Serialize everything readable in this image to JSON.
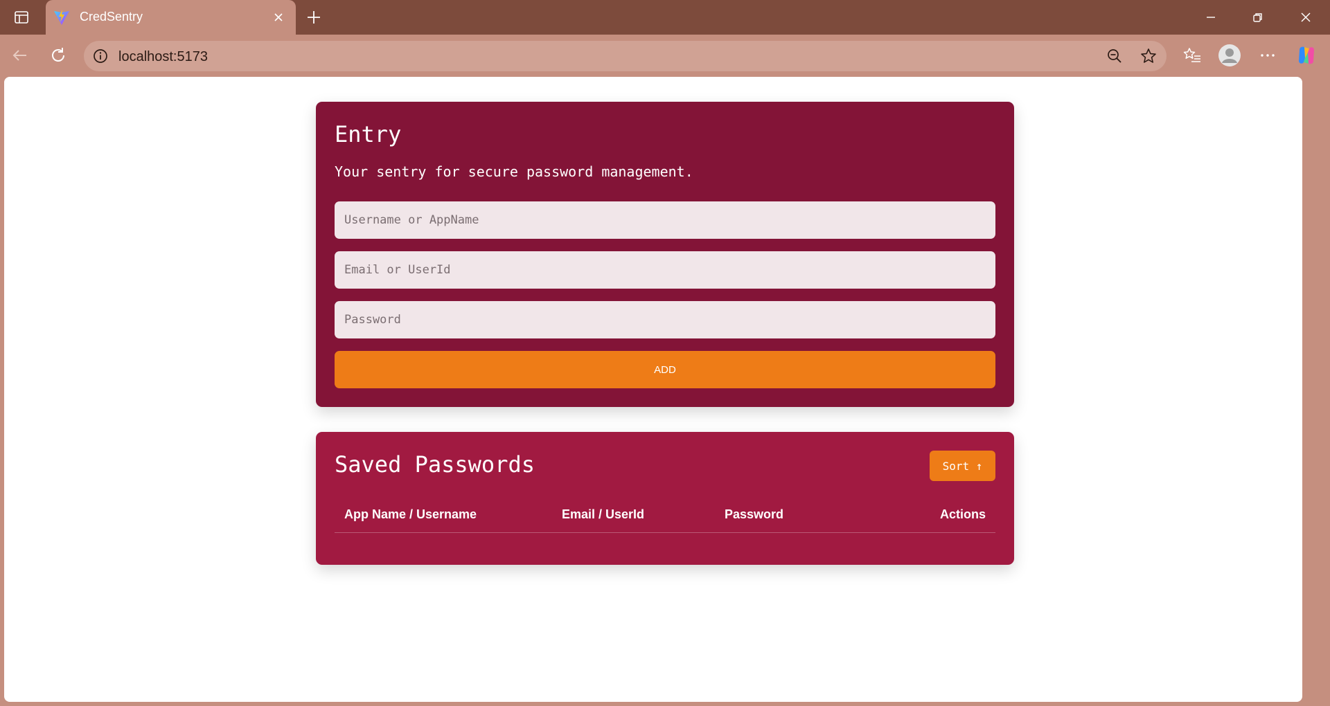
{
  "browser": {
    "tab_title": "CredSentry",
    "url": "localhost:5173"
  },
  "entry": {
    "title": "Entry",
    "subtitle": "Your sentry for secure password management.",
    "username_placeholder": "Username or AppName",
    "email_placeholder": "Email or UserId",
    "password_placeholder": "Password",
    "add_label": "ADD"
  },
  "saved": {
    "title": "Saved Passwords",
    "sort_label": "Sort ↑",
    "columns": [
      "App Name / Username",
      "Email / UserId",
      "Password",
      "Actions"
    ],
    "rows": []
  },
  "colors": {
    "entry_bg": "#831437",
    "saved_bg": "#a11a41",
    "accent": "#ee7c17",
    "chrome": "#c58f7f"
  }
}
